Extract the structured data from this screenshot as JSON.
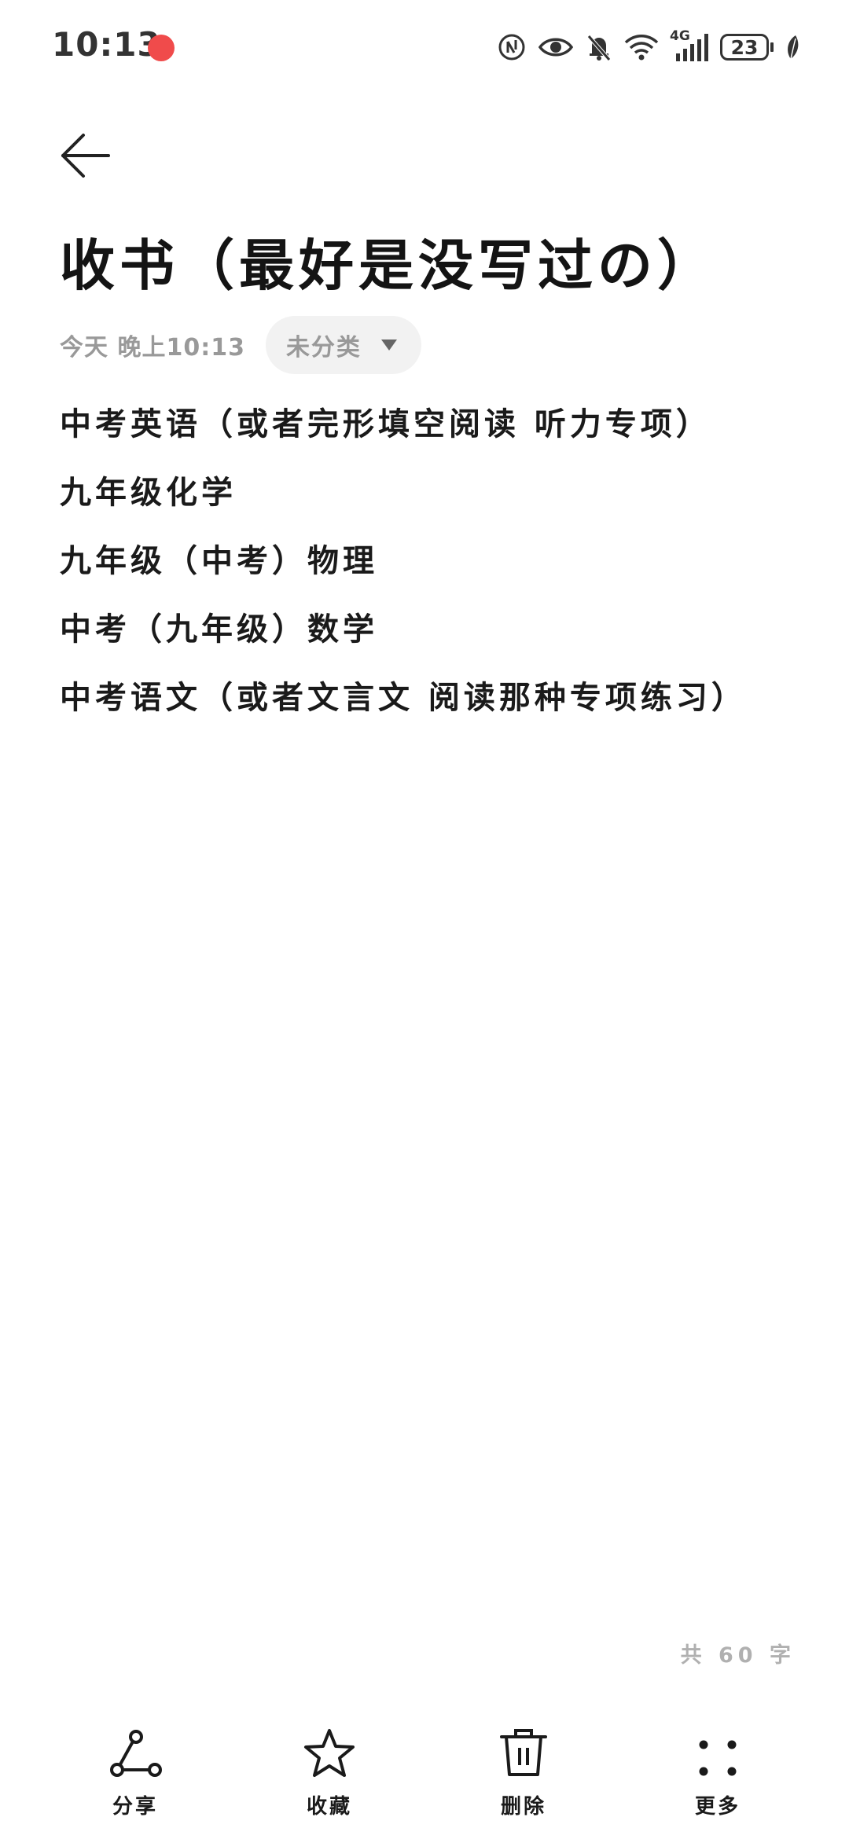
{
  "status_bar": {
    "time": "10:13",
    "network_label": "4G",
    "battery_level": "23"
  },
  "note": {
    "title": "收书（最好是没写过の）",
    "date": "今天  晚上10:13",
    "category": "未分类",
    "lines": [
      "中考英语（或者完形填空阅读 听力专项）",
      "九年级化学",
      "九年级（中考）物理",
      "中考（九年级）数学",
      "中考语文（或者文言文 阅读那种专项练习）"
    ],
    "word_count": "共 60 字"
  },
  "toolbar": {
    "share_label": "分享",
    "favorite_label": "收藏",
    "delete_label": "删除",
    "more_label": "更多"
  },
  "icons": {
    "back": "arrow-left-icon",
    "share": "share-icon",
    "favorite": "star-icon",
    "delete": "trash-icon",
    "more": "more-dots-icon",
    "dropdown": "caret-down-icon"
  }
}
